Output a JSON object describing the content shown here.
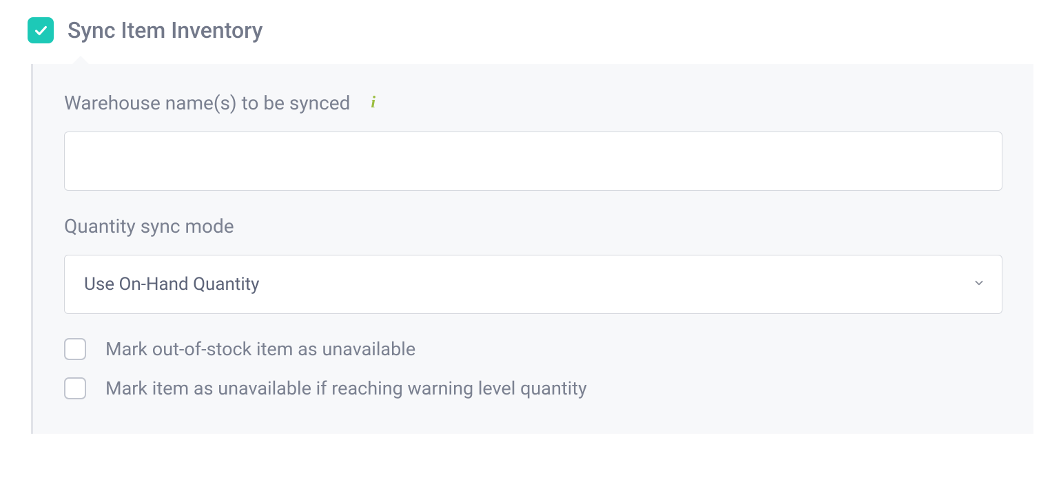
{
  "header": {
    "title": "Sync Item Inventory",
    "checked": true
  },
  "warehouse": {
    "label": "Warehouse name(s) to be synced",
    "value": ""
  },
  "quantityMode": {
    "label": "Quantity sync mode",
    "selected": "Use On-Hand Quantity"
  },
  "options": {
    "outOfStock": {
      "label": "Mark out-of-stock item as unavailable",
      "checked": false
    },
    "warningLevel": {
      "label": "Mark item as unavailable if reaching warning level quantity",
      "checked": false
    }
  }
}
